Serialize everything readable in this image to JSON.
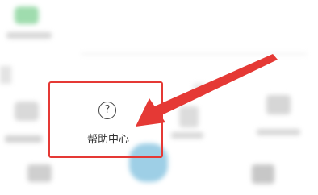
{
  "help_center": {
    "icon": "question-circle-icon",
    "icon_glyph": "?",
    "label": "帮助中心"
  },
  "annotation": {
    "box_color": "#e53935",
    "arrow_color": "#e53935"
  }
}
